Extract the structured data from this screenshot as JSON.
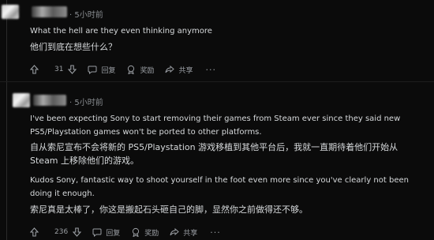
{
  "comments": [
    {
      "time": "5小时前",
      "lines": [
        "What the hell are they even thinking anymore",
        "他们到底在想些什么？"
      ],
      "votes": "31",
      "actions": {
        "reply": "回复",
        "award": "奖励",
        "share": "共享",
        "more": "···"
      }
    },
    {
      "time": "5小时前",
      "lines": [
        "I've been expecting Sony to start removing their games from Steam ever since they said new PS5/Playstation games won't be ported to other platforms.",
        "自从索尼宣布不会将新的 PS5/Playstation 游戏移植到其他平台后，我就一直期待着他们开始从 Steam 上移除他们的游戏。",
        "Kudos Sony, fantastic way to shoot yourself in the foot even more since you've clearly not been doing it enough.",
        "索尼真是太棒了，你这是搬起石头砸自己的脚，显然你之前做得还不够。"
      ],
      "votes": "236",
      "actions": {
        "reply": "回复",
        "award": "奖励",
        "share": "共享",
        "more": "···"
      }
    }
  ],
  "icons": {
    "upvote": "arrow-up-icon",
    "downvote": "arrow-down-icon",
    "reply": "speech-bubble-icon",
    "award": "award-icon",
    "share": "share-icon"
  },
  "colors": {
    "background": "#0b0b0b",
    "text": "#d7dadc",
    "muted": "#8b8f93"
  }
}
